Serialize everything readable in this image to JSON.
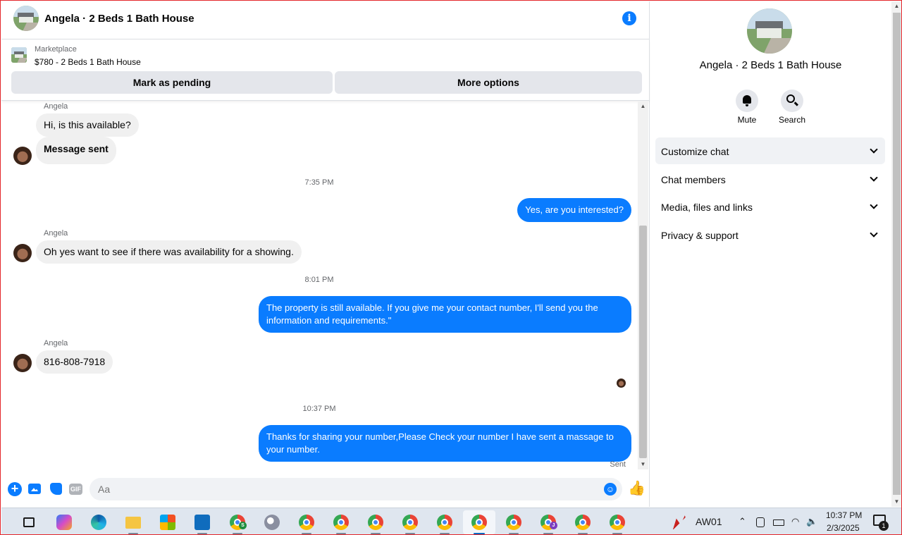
{
  "header": {
    "title": "Angela · 2 Beds 1 Bath House",
    "info_icon": "info-icon"
  },
  "listing": {
    "kicker": "Marketplace",
    "title": "$780 - 2 Beds 1 Bath House",
    "mark_pending_label": "Mark as pending",
    "more_options_label": "More options"
  },
  "messages": {
    "sender_1": "Angela",
    "msg_1": "Hi, is this available?",
    "msg_2": "Message sent",
    "time_1": "7:35 PM",
    "out_1": "Yes, are you interested?",
    "sender_2": "Angela",
    "msg_3": "Oh yes want to see if there was availability for a showing.",
    "time_2": "8:01 PM",
    "out_2": "The property is still available. If you give me your contact number, I'll send you the information and requirements.\"",
    "sender_3": "Angela",
    "msg_4": "816-808-7918",
    "time_3": "10:37 PM",
    "out_3": "Thanks for sharing your number,Please Check your number I have sent a massage to your number.",
    "sent_label": "Sent"
  },
  "composer": {
    "placeholder": "Aa",
    "gif_label": "GIF"
  },
  "panel": {
    "title": "Angela · 2 Beds 1 Bath House",
    "mute_label": "Mute",
    "search_label": "Search",
    "rows": [
      {
        "label": "Customize chat"
      },
      {
        "label": "Chat members"
      },
      {
        "label": "Media, files and links"
      },
      {
        "label": "Privacy & support"
      }
    ]
  },
  "taskbar": {
    "apps": [
      "task-view-icon",
      "copilot-icon",
      "edge-icon",
      "file-explorer-icon",
      "microsoft-store-icon",
      "outlook-icon",
      "chrome-profile-s-icon",
      "paint-icon",
      "chrome-icon",
      "chrome-icon",
      "chrome-icon",
      "chrome-icon",
      "chrome-icon",
      "chrome-icon",
      "chrome-icon",
      "chrome-profile-j-icon",
      "chrome-icon",
      "chrome-icon"
    ],
    "profile_s": "S",
    "profile_j": "J",
    "aw_label": "AW01",
    "time": "10:37 PM",
    "date": "2/3/2025",
    "notifications": "1"
  },
  "colors": {
    "accent": "#0a7cff",
    "bubble_in": "#f0f0f0",
    "frame": "#e4262b"
  }
}
